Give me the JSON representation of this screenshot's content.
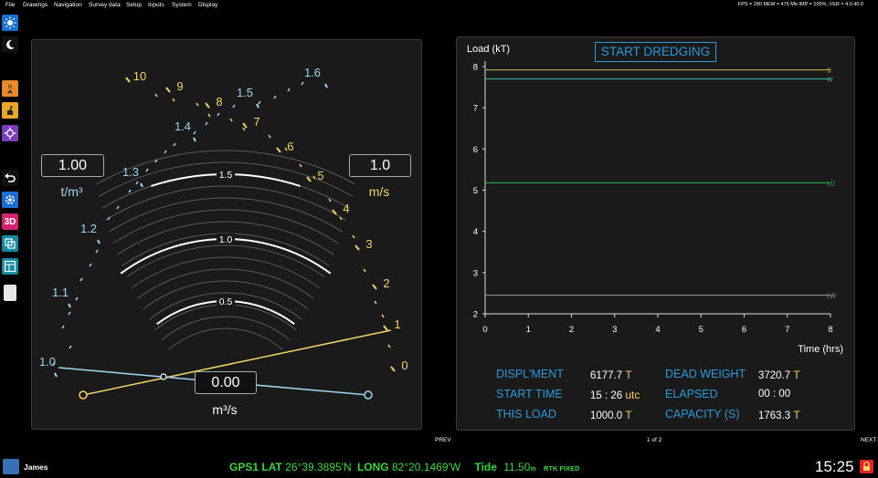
{
  "menu": [
    "File",
    "Drawings",
    "Navigation",
    "Survey data",
    "Setup",
    "Inputs",
    "System",
    "Display"
  ],
  "system_status": "FPS = 280 MEM = 476 Mb IMP = 100%, VER = 4.0.40.0",
  "toolbar_icons": [
    "sun-icon",
    "moon-icon",
    "north-arrow-icon",
    "excavator-icon",
    "crosshair-icon",
    "undo-icon",
    "settings-gear-icon",
    "3d-view-icon",
    "layers-icon",
    "table-icon",
    "blank-page-icon"
  ],
  "gauge": {
    "density_value": "1.00",
    "density_unit": "t/m³",
    "velocity_value": "1.0",
    "velocity_unit": "m/s",
    "production_value": "0.00",
    "production_unit": "m³/s",
    "density_scale": [
      "1.0",
      "1.1",
      "1.2",
      "1.3",
      "1.4",
      "1.5",
      "1.6"
    ],
    "velocity_scale": [
      "0",
      "1",
      "2",
      "3",
      "4",
      "5",
      "6",
      "7",
      "8",
      "9",
      "10"
    ],
    "production_curves": [
      "0.5",
      "1.0",
      "1.5"
    ],
    "colors": {
      "density": "#9fd6f2",
      "velocity": "#f5d36a",
      "curve": "#ffffff"
    }
  },
  "start_button": "START DREDGING",
  "chart_data": {
    "type": "line",
    "ylabel": "Load (kT)",
    "xlabel": "Time (hrs)",
    "xlim": [
      0,
      8
    ],
    "ylim": [
      2,
      8
    ],
    "x_ticks": [
      "0",
      "1",
      "2",
      "3",
      "4",
      "5",
      "6",
      "7",
      "8"
    ],
    "y_ticks": [
      "2",
      "3",
      "4",
      "5",
      "6",
      "7",
      "8"
    ],
    "series": [
      {
        "name": "S",
        "color": "#c8b84a",
        "x": [
          0,
          8
        ],
        "y": [
          7.92,
          7.92
        ]
      },
      {
        "name": "W",
        "color": "#45b0b0",
        "x": [
          0,
          8
        ],
        "y": [
          7.7,
          7.7
        ]
      },
      {
        "name": "LD",
        "color": "#2fb84a",
        "x": [
          0,
          8
        ],
        "y": [
          5.18,
          5.18
        ]
      },
      {
        "name": "LW",
        "color": "#999999",
        "x": [
          0,
          8
        ],
        "y": [
          2.45,
          2.45
        ]
      }
    ]
  },
  "stats": {
    "displacement_label": "DISPL'MENT",
    "displacement_value": "6177.7",
    "displacement_unit": "T",
    "deadweight_label": "DEAD WEIGHT",
    "deadweight_value": "3720.7",
    "deadweight_unit": "T",
    "start_time_label": "START TIME",
    "start_time_value": "15 : 26",
    "start_time_unit": "utc",
    "elapsed_label": "ELAPSED",
    "elapsed_value": "00 : 00",
    "this_load_label": "THIS LOAD",
    "this_load_value": "1000.0",
    "this_load_unit": "T",
    "capacity_label": "CAPACITY (S)",
    "capacity_value": "1763.3",
    "capacity_unit": "T"
  },
  "pager": {
    "prev": "PREV",
    "page": "1 of 2",
    "next": "NEXT"
  },
  "status": {
    "user": "James",
    "gps_label": "GPS1",
    "lat_label": "LAT",
    "lat_value": "26°39.3895'N",
    "long_label": "LONG",
    "long_value": "82°20.1469'W",
    "tide_label": "Tide",
    "tide_value": "11.50",
    "tide_unit": "m",
    "rtk": "RTK FIXED",
    "time": "15:25",
    "colors": {
      "gps": "#3ed43e",
      "time": "#ffffff",
      "lock": "#e02424"
    }
  }
}
